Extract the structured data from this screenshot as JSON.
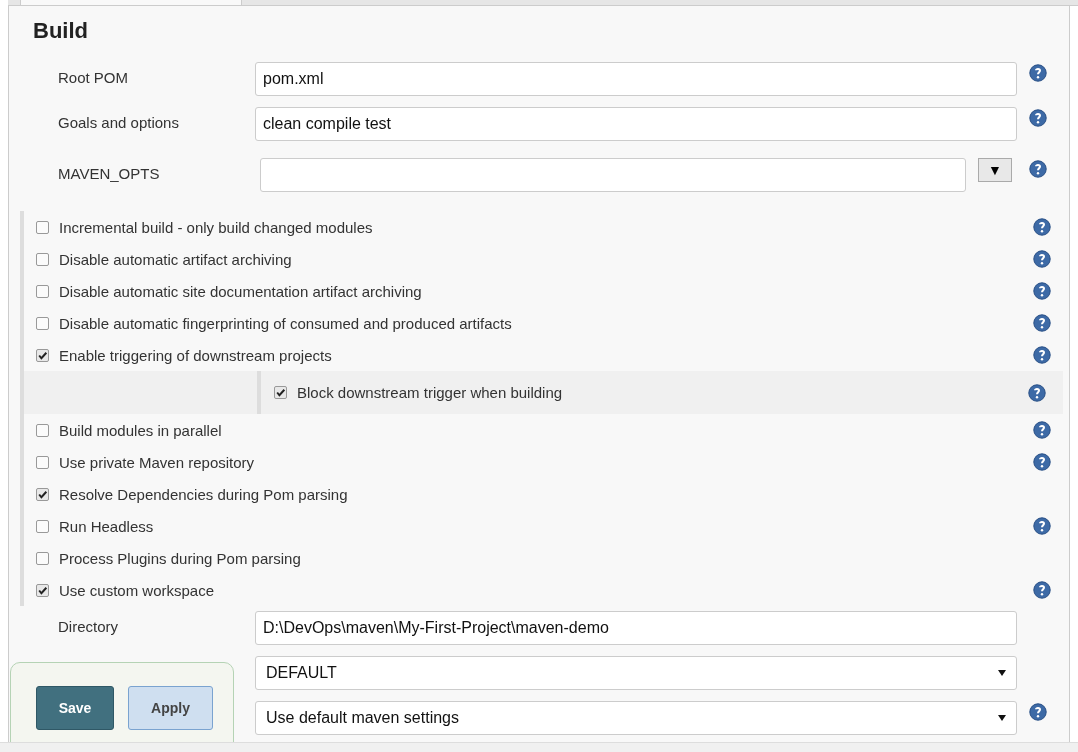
{
  "section": {
    "title": "Build"
  },
  "top_fields": [
    {
      "kind": "text",
      "label": "Root POM",
      "value": "pom.xml",
      "help": true
    },
    {
      "kind": "text",
      "label": "Goals and options",
      "value": "clean compile test",
      "help": true
    },
    {
      "kind": "expandable",
      "label": "MAVEN_OPTS",
      "expand_icon": "▼",
      "help": true
    }
  ],
  "options": [
    {
      "label": "Incremental build - only build changed modules",
      "checked": false,
      "help": true
    },
    {
      "label": "Disable automatic artifact archiving",
      "checked": false,
      "help": true
    },
    {
      "label": "Disable automatic site documentation artifact archiving",
      "checked": false,
      "help": true
    },
    {
      "label": "Disable automatic fingerprinting of consumed and produced artifacts",
      "checked": false,
      "help": true
    },
    {
      "label": "Enable triggering of downstream projects",
      "checked": true,
      "help": true,
      "children": [
        {
          "label": "Block downstream trigger when building",
          "checked": true,
          "help": true
        }
      ]
    },
    {
      "label": "Build modules in parallel",
      "checked": false,
      "help": true
    },
    {
      "label": "Use private Maven repository",
      "checked": false,
      "help": true
    },
    {
      "label": "Resolve Dependencies during Pom parsing",
      "checked": true,
      "help": false
    },
    {
      "label": "Run Headless",
      "checked": false,
      "help": true
    },
    {
      "label": "Process Plugins during Pom parsing",
      "checked": false,
      "help": false
    },
    {
      "label": "Use custom workspace",
      "checked": true,
      "help": true
    }
  ],
  "bottom_fields": [
    {
      "kind": "text",
      "label": "Directory",
      "value": "D:\\DevOps\\maven\\My-First-Project\\maven-demo",
      "help": false
    },
    {
      "kind": "select",
      "value": "DEFAULT",
      "help": false
    },
    {
      "kind": "select",
      "value": "Use default maven settings",
      "help": true
    }
  ],
  "actions": [
    {
      "kind": "primary",
      "label": "Save"
    },
    {
      "kind": "secondary",
      "label": "Apply"
    }
  ]
}
